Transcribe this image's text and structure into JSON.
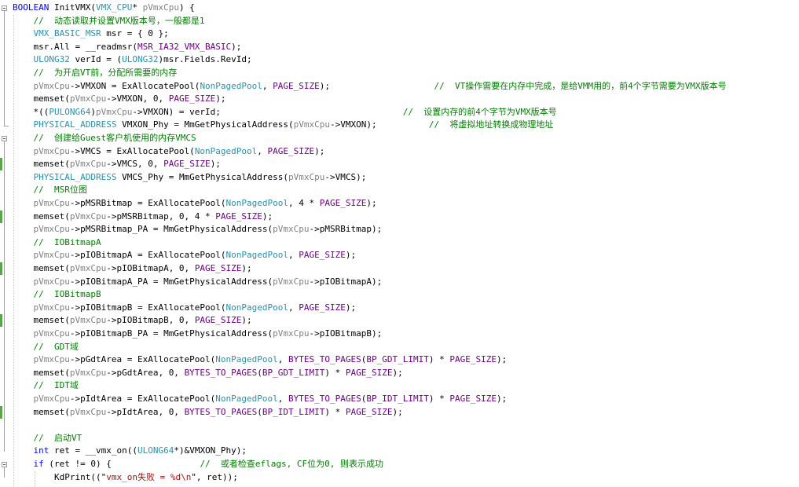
{
  "editor": {
    "colors": {
      "background": "#ffffff",
      "keyword": "#0000ff",
      "type": "#2b91af",
      "macro": "#6f008a",
      "parameter": "#808080",
      "string": "#a31515",
      "comment": "#008000",
      "change_bar": "#57a64a"
    },
    "lines": [
      {
        "fold": "open",
        "change": false,
        "tokens": [
          {
            "c": "kw",
            "t": "BOOLEAN"
          },
          {
            "c": "plain",
            "t": " InitVMX("
          },
          {
            "c": "ty",
            "t": "VMX_CPU"
          },
          {
            "c": "plain",
            "t": "* "
          },
          {
            "c": "param",
            "t": "pVmxCpu"
          },
          {
            "c": "plain",
            "t": ") {"
          }
        ]
      },
      {
        "change": false,
        "tokens": [
          {
            "c": "plain",
            "t": "    "
          },
          {
            "c": "cm",
            "t": "//  动态读取并设置VMX版本号，一般都是1"
          }
        ]
      },
      {
        "change": false,
        "tokens": [
          {
            "c": "plain",
            "t": "    "
          },
          {
            "c": "ty",
            "t": "VMX_BASIC_MSR"
          },
          {
            "c": "plain",
            "t": " msr = { 0 };"
          }
        ]
      },
      {
        "change": false,
        "tokens": [
          {
            "c": "plain",
            "t": "    msr.All = __readmsr("
          },
          {
            "c": "mac",
            "t": "MSR_IA32_VMX_BASIC"
          },
          {
            "c": "plain",
            "t": ");"
          }
        ]
      },
      {
        "change": false,
        "tokens": [
          {
            "c": "plain",
            "t": "    "
          },
          {
            "c": "ty",
            "t": "ULONG32"
          },
          {
            "c": "plain",
            "t": " verId = ("
          },
          {
            "c": "ty",
            "t": "ULONG32"
          },
          {
            "c": "plain",
            "t": ")msr.Fields.RevId;"
          }
        ]
      },
      {
        "change": false,
        "tokens": [
          {
            "c": "plain",
            "t": "    "
          },
          {
            "c": "cm",
            "t": "//  为开启VT前，分配所需要的内存"
          }
        ]
      },
      {
        "change": false,
        "tokens": [
          {
            "c": "plain",
            "t": "    "
          },
          {
            "c": "param",
            "t": "pVmxCpu"
          },
          {
            "c": "plain",
            "t": "->VMXON = ExAllocatePool("
          },
          {
            "c": "ty",
            "t": "NonPagedPool"
          },
          {
            "c": "plain",
            "t": ", "
          },
          {
            "c": "mac",
            "t": "PAGE_SIZE"
          },
          {
            "c": "plain",
            "t": ");                    "
          },
          {
            "c": "cm",
            "t": "//  VT操作需要在内存中完成，是给VMM用的，前4个字节需要为VMX版本号"
          }
        ]
      },
      {
        "change": false,
        "tokens": [
          {
            "c": "plain",
            "t": "    memset("
          },
          {
            "c": "param",
            "t": "pVmxCpu"
          },
          {
            "c": "plain",
            "t": "->VMXON, 0, "
          },
          {
            "c": "mac",
            "t": "PAGE_SIZE"
          },
          {
            "c": "plain",
            "t": ");"
          }
        ]
      },
      {
        "change": false,
        "tokens": [
          {
            "c": "plain",
            "t": "    *(("
          },
          {
            "c": "ty",
            "t": "PULONG64"
          },
          {
            "c": "plain",
            "t": ")"
          },
          {
            "c": "param",
            "t": "pVmxCpu"
          },
          {
            "c": "plain",
            "t": "->VMXON) = verId;                                   "
          },
          {
            "c": "cm",
            "t": "//  设置内存的前4个字节为VMX版本号"
          }
        ]
      },
      {
        "change": false,
        "tokens": [
          {
            "c": "plain",
            "t": "    "
          },
          {
            "c": "ty",
            "t": "PHYSICAL_ADDRESS"
          },
          {
            "c": "plain",
            "t": " VMXON_Phy = MmGetPhysicalAddress("
          },
          {
            "c": "param",
            "t": "pVmxCpu"
          },
          {
            "c": "plain",
            "t": "->VMXON);          "
          },
          {
            "c": "cm",
            "t": "//  将虚拟地址转换成物理地址"
          }
        ]
      },
      {
        "fold": "open",
        "change": false,
        "tokens": [
          {
            "c": "plain",
            "t": "    "
          },
          {
            "c": "cm",
            "t": "//  创建给Guest客户机使用的内存VMCS"
          }
        ]
      },
      {
        "change": false,
        "tokens": [
          {
            "c": "plain",
            "t": "    "
          },
          {
            "c": "param",
            "t": "pVmxCpu"
          },
          {
            "c": "plain",
            "t": "->VMCS = ExAllocatePool("
          },
          {
            "c": "ty",
            "t": "NonPagedPool"
          },
          {
            "c": "plain",
            "t": ", "
          },
          {
            "c": "mac",
            "t": "PAGE_SIZE"
          },
          {
            "c": "plain",
            "t": ");"
          }
        ]
      },
      {
        "change": true,
        "tokens": [
          {
            "c": "plain",
            "t": "    memset("
          },
          {
            "c": "param",
            "t": "pVmxCpu"
          },
          {
            "c": "plain",
            "t": "->VMCS, 0, "
          },
          {
            "c": "mac",
            "t": "PAGE_SIZE"
          },
          {
            "c": "plain",
            "t": ");"
          }
        ]
      },
      {
        "change": false,
        "tokens": [
          {
            "c": "plain",
            "t": "    "
          },
          {
            "c": "ty",
            "t": "PHYSICAL_ADDRESS"
          },
          {
            "c": "plain",
            "t": " VMCS_Phy = MmGetPhysicalAddress("
          },
          {
            "c": "param",
            "t": "pVmxCpu"
          },
          {
            "c": "plain",
            "t": "->VMCS);"
          }
        ]
      },
      {
        "change": false,
        "tokens": [
          {
            "c": "plain",
            "t": "    "
          },
          {
            "c": "cm",
            "t": "//  MSR位图"
          }
        ]
      },
      {
        "change": false,
        "tokens": [
          {
            "c": "plain",
            "t": "    "
          },
          {
            "c": "param",
            "t": "pVmxCpu"
          },
          {
            "c": "plain",
            "t": "->pMSRBitmap = ExAllocatePool("
          },
          {
            "c": "ty",
            "t": "NonPagedPool"
          },
          {
            "c": "plain",
            "t": ", 4 * "
          },
          {
            "c": "mac",
            "t": "PAGE_SIZE"
          },
          {
            "c": "plain",
            "t": ");"
          }
        ]
      },
      {
        "change": true,
        "tokens": [
          {
            "c": "plain",
            "t": "    memset("
          },
          {
            "c": "param",
            "t": "pVmxCpu"
          },
          {
            "c": "plain",
            "t": "->pMSRBitmap, 0, 4 * "
          },
          {
            "c": "mac",
            "t": "PAGE_SIZE"
          },
          {
            "c": "plain",
            "t": ");"
          }
        ]
      },
      {
        "change": false,
        "tokens": [
          {
            "c": "plain",
            "t": "    "
          },
          {
            "c": "param",
            "t": "pVmxCpu"
          },
          {
            "c": "plain",
            "t": "->pMSRBitmap_PA = MmGetPhysicalAddress("
          },
          {
            "c": "param",
            "t": "pVmxCpu"
          },
          {
            "c": "plain",
            "t": "->pMSRBitmap);"
          }
        ]
      },
      {
        "change": false,
        "tokens": [
          {
            "c": "plain",
            "t": "    "
          },
          {
            "c": "cm",
            "t": "//  IOBitmapA"
          }
        ]
      },
      {
        "change": false,
        "tokens": [
          {
            "c": "plain",
            "t": "    "
          },
          {
            "c": "param",
            "t": "pVmxCpu"
          },
          {
            "c": "plain",
            "t": "->pIOBitmapA = ExAllocatePool("
          },
          {
            "c": "ty",
            "t": "NonPagedPool"
          },
          {
            "c": "plain",
            "t": ", "
          },
          {
            "c": "mac",
            "t": "PAGE_SIZE"
          },
          {
            "c": "plain",
            "t": ");"
          }
        ]
      },
      {
        "change": true,
        "tokens": [
          {
            "c": "plain",
            "t": "    memset("
          },
          {
            "c": "param",
            "t": "pVmxCpu"
          },
          {
            "c": "plain",
            "t": "->pIOBitmapA, 0, "
          },
          {
            "c": "mac",
            "t": "PAGE_SIZE"
          },
          {
            "c": "plain",
            "t": ");"
          }
        ]
      },
      {
        "change": false,
        "tokens": [
          {
            "c": "plain",
            "t": "    "
          },
          {
            "c": "param",
            "t": "pVmxCpu"
          },
          {
            "c": "plain",
            "t": "->pIOBitmapA_PA = MmGetPhysicalAddress("
          },
          {
            "c": "param",
            "t": "pVmxCpu"
          },
          {
            "c": "plain",
            "t": "->pIOBitmapA);"
          }
        ]
      },
      {
        "change": false,
        "tokens": [
          {
            "c": "plain",
            "t": "    "
          },
          {
            "c": "cm",
            "t": "//  IOBitmapB"
          }
        ]
      },
      {
        "change": false,
        "tokens": [
          {
            "c": "plain",
            "t": "    "
          },
          {
            "c": "param",
            "t": "pVmxCpu"
          },
          {
            "c": "plain",
            "t": "->pIOBitmapB = ExAllocatePool("
          },
          {
            "c": "ty",
            "t": "NonPagedPool"
          },
          {
            "c": "plain",
            "t": ", "
          },
          {
            "c": "mac",
            "t": "PAGE_SIZE"
          },
          {
            "c": "plain",
            "t": ");"
          }
        ]
      },
      {
        "change": true,
        "tokens": [
          {
            "c": "plain",
            "t": "    memset("
          },
          {
            "c": "param",
            "t": "pVmxCpu"
          },
          {
            "c": "plain",
            "t": "->pIOBitmapB, 0, "
          },
          {
            "c": "mac",
            "t": "PAGE_SIZE"
          },
          {
            "c": "plain",
            "t": ");"
          }
        ]
      },
      {
        "change": false,
        "tokens": [
          {
            "c": "plain",
            "t": "    "
          },
          {
            "c": "param",
            "t": "pVmxCpu"
          },
          {
            "c": "plain",
            "t": "->pIOBitmapB_PA = MmGetPhysicalAddress("
          },
          {
            "c": "param",
            "t": "pVmxCpu"
          },
          {
            "c": "plain",
            "t": "->pIOBitmapB);"
          }
        ]
      },
      {
        "change": false,
        "tokens": [
          {
            "c": "plain",
            "t": "    "
          },
          {
            "c": "cm",
            "t": "//  GDT域"
          }
        ]
      },
      {
        "change": false,
        "tokens": [
          {
            "c": "plain",
            "t": "    "
          },
          {
            "c": "param",
            "t": "pVmxCpu"
          },
          {
            "c": "plain",
            "t": "->pGdtArea = ExAllocatePool("
          },
          {
            "c": "ty",
            "t": "NonPagedPool"
          },
          {
            "c": "plain",
            "t": ", "
          },
          {
            "c": "mac",
            "t": "BYTES_TO_PAGES"
          },
          {
            "c": "plain",
            "t": "("
          },
          {
            "c": "mac",
            "t": "BP_GDT_LIMIT"
          },
          {
            "c": "plain",
            "t": ") * "
          },
          {
            "c": "mac",
            "t": "PAGE_SIZE"
          },
          {
            "c": "plain",
            "t": ");"
          }
        ]
      },
      {
        "change": false,
        "tokens": [
          {
            "c": "plain",
            "t": "    memset("
          },
          {
            "c": "param",
            "t": "pVmxCpu"
          },
          {
            "c": "plain",
            "t": "->pGdtArea, 0, "
          },
          {
            "c": "mac",
            "t": "BYTES_TO_PAGES"
          },
          {
            "c": "plain",
            "t": "("
          },
          {
            "c": "mac",
            "t": "BP_GDT_LIMIT"
          },
          {
            "c": "plain",
            "t": ") * "
          },
          {
            "c": "mac",
            "t": "PAGE_SIZE"
          },
          {
            "c": "plain",
            "t": ");"
          }
        ]
      },
      {
        "change": false,
        "tokens": [
          {
            "c": "plain",
            "t": "    "
          },
          {
            "c": "cm",
            "t": "//  IDT域"
          }
        ]
      },
      {
        "change": false,
        "tokens": [
          {
            "c": "plain",
            "t": "    "
          },
          {
            "c": "param",
            "t": "pVmxCpu"
          },
          {
            "c": "plain",
            "t": "->pIdtArea = ExAllocatePool("
          },
          {
            "c": "ty",
            "t": "NonPagedPool"
          },
          {
            "c": "plain",
            "t": ", "
          },
          {
            "c": "mac",
            "t": "BYTES_TO_PAGES"
          },
          {
            "c": "plain",
            "t": "("
          },
          {
            "c": "mac",
            "t": "BP_IDT_LIMIT"
          },
          {
            "c": "plain",
            "t": ") * "
          },
          {
            "c": "mac",
            "t": "PAGE_SIZE"
          },
          {
            "c": "plain",
            "t": ");"
          }
        ]
      },
      {
        "change": true,
        "tokens": [
          {
            "c": "plain",
            "t": "    memset("
          },
          {
            "c": "param",
            "t": "pVmxCpu"
          },
          {
            "c": "plain",
            "t": "->pIdtArea, 0, "
          },
          {
            "c": "mac",
            "t": "BYTES_TO_PAGES"
          },
          {
            "c": "plain",
            "t": "("
          },
          {
            "c": "mac",
            "t": "BP_IDT_LIMIT"
          },
          {
            "c": "plain",
            "t": ") * "
          },
          {
            "c": "mac",
            "t": "PAGE_SIZE"
          },
          {
            "c": "plain",
            "t": ");"
          }
        ]
      },
      {
        "change": false,
        "tokens": []
      },
      {
        "change": false,
        "tokens": [
          {
            "c": "plain",
            "t": "    "
          },
          {
            "c": "cm",
            "t": "//  启动VT"
          }
        ]
      },
      {
        "change": false,
        "tokens": [
          {
            "c": "plain",
            "t": "    "
          },
          {
            "c": "kw",
            "t": "int"
          },
          {
            "c": "plain",
            "t": " ret = __vmx_on(("
          },
          {
            "c": "ty",
            "t": "ULONG64"
          },
          {
            "c": "plain",
            "t": "*)&VMXON_Phy);"
          }
        ]
      },
      {
        "fold": "open",
        "change": false,
        "tokens": [
          {
            "c": "plain",
            "t": "    "
          },
          {
            "c": "kw",
            "t": "if"
          },
          {
            "c": "plain",
            "t": " (ret != 0) {                 "
          },
          {
            "c": "cm",
            "t": "//  或者检查eflags, CF位为0, 则表示成功"
          }
        ]
      },
      {
        "change": false,
        "tokens": [
          {
            "c": "plain",
            "t": "        KdPrint((\""
          },
          {
            "c": "str",
            "t": "vmx_on失败 = %d\\n"
          },
          {
            "c": "plain",
            "t": "\", ret));"
          }
        ]
      }
    ]
  }
}
